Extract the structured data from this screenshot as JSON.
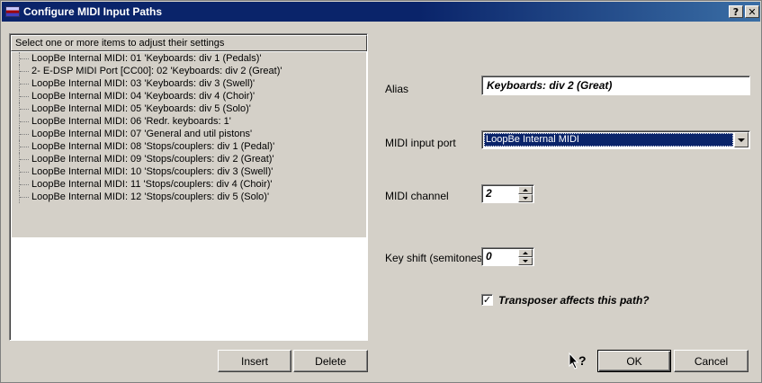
{
  "window": {
    "title": "Configure MIDI Input Paths",
    "help_glyph": "?",
    "close_glyph": "✕"
  },
  "list": {
    "header": "Select one or more items to adjust their settings",
    "items": [
      "LoopBe Internal MIDI: 01 'Keyboards: div 1 (Pedals)'",
      "2- E-DSP MIDI Port [CC00]: 02 'Keyboards: div 2 (Great)'",
      "LoopBe Internal MIDI: 03 'Keyboards: div 3 (Swell)'",
      "LoopBe Internal MIDI: 04 'Keyboards: div 4 (Choir)'",
      "LoopBe Internal MIDI: 05 'Keyboards: div 5 (Solo)'",
      "LoopBe Internal MIDI: 06 'Redr. keyboards: 1'",
      "LoopBe Internal MIDI: 07 'General and util pistons'",
      "LoopBe Internal MIDI: 08 'Stops/couplers: div 1 (Pedal)'",
      "LoopBe Internal MIDI: 09 'Stops/couplers: div 2 (Great)'",
      "LoopBe Internal MIDI: 10 'Stops/couplers: div 3 (Swell)'",
      "LoopBe Internal MIDI: 11 'Stops/couplers: div 4 (Choir)'",
      "LoopBe Internal MIDI: 12 'Stops/couplers: div 5 (Solo)'"
    ]
  },
  "buttons": {
    "insert": "Insert",
    "delete": "Delete",
    "ok": "OK",
    "cancel": "Cancel"
  },
  "form": {
    "alias_label": "Alias",
    "alias_value": "Keyboards: div 2 (Great)",
    "port_label": "MIDI input port",
    "port_value": "LoopBe Internal MIDI",
    "channel_label": "MIDI channel",
    "channel_value": "2",
    "keyshift_label": "Key shift (semitones)",
    "keyshift_value": "0",
    "transposer_label": "Transposer affects this path?",
    "transposer_checked_glyph": "✓"
  },
  "colors": {
    "title_bar": "#0a246a",
    "selection": "#0a246a",
    "face": "#d4d0c8"
  }
}
